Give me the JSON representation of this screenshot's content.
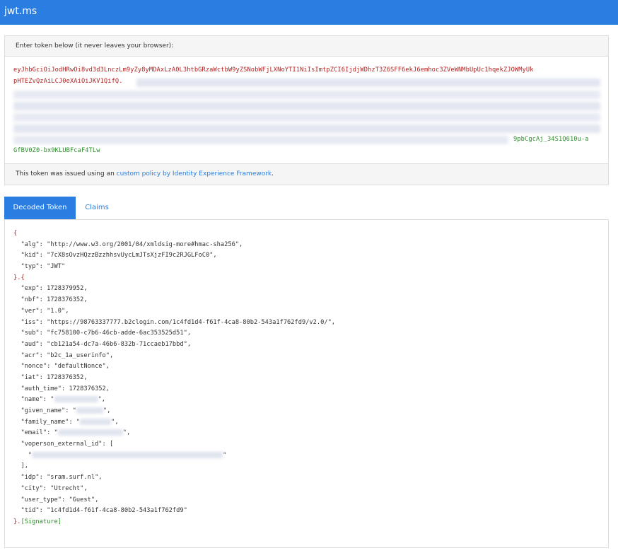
{
  "app": {
    "title": "jwt.ms"
  },
  "token_panel": {
    "header": "Enter token below (it never leaves your browser):",
    "line1": "eyJhbGciOiJodHRwOi8vd3d3LnczLm9yZy8yMDAxLzA0L3htbGRzaWctbW9yZSNobWFjLXNoYTI1NiIsImtpZCI6IjdjWDhzT3Z6SFF6ekJ6emhoc3ZVeWNMbUpUc1hqekZJOWMyUk",
    "line2_start": "pHTEZvQzAiLCJ0eXAiOiJKV1QifQ.",
    "line6_end": "9pbCgcAj_34S1Q610u-a",
    "line7": "GfBV0Z0-bx9KLUBFcaF4TLw",
    "footer_prefix": "This token was issued using an ",
    "footer_link": "custom policy by Identity Experience Framework",
    "footer_suffix": "."
  },
  "tabs": [
    {
      "label": "Decoded Token",
      "active": true
    },
    {
      "label": "Claims",
      "active": false
    }
  ],
  "decoded": {
    "lines": [
      "{",
      "  \"alg\": \"http://www.w3.org/2001/04/xmldsig-more#hmac-sha256\",",
      "  \"kid\": \"7cX8sOvzHQzzBzzhhsvUycLmJTsXjzFI9c2RJGLFoC0\",",
      "  \"typ\": \"JWT\"",
      "}.{",
      "  \"exp\": 1728379952,",
      "  \"nbf\": 1728376352,",
      "  \"ver\": \"1.0\",",
      "  \"iss\": \"https://98763337777.b2clogin.com/1c4fd1d4-f61f-4ca8-80b2-543a1f762fd9/v2.0/\",",
      "  \"sub\": \"fc758100-c7b6-46cb-adde-6ac353525d51\",",
      "  \"aud\": \"cb121a54-dc7a-46b6-832b-71ccaeb17bbd\",",
      "  \"acr\": \"b2c_1a_userinfo\",",
      "  \"nonce\": \"defaultNonce\",",
      "  \"iat\": 1728376352,",
      "  \"auth_time\": 1728376352,"
    ],
    "name_prefix": "  \"name\": \"",
    "name_suffix": "\",",
    "given_name_prefix": "  \"given_name\": \"",
    "given_name_suffix": "\",",
    "family_name_prefix": "  \"family_name\": \"",
    "family_name_suffix": "\",",
    "email_prefix": "  \"email\": \"",
    "email_suffix": "\",",
    "voperson_line": "  \"voperson_external_id\": [",
    "voperson_item_prefix": "    \"",
    "voperson_item_suffix": "\"",
    "lines_after": [
      "  ],",
      "  \"idp\": \"sram.surf.nl\",",
      "  \"city\": \"Utrecht\",",
      "  \"user_type\": \"Guest\",",
      "  \"tid\": \"1c4fd1d4-f61f-4ca8-80b2-543a1f762fd9\""
    ],
    "end_prefix": "}.",
    "signature": "[Signature]"
  }
}
